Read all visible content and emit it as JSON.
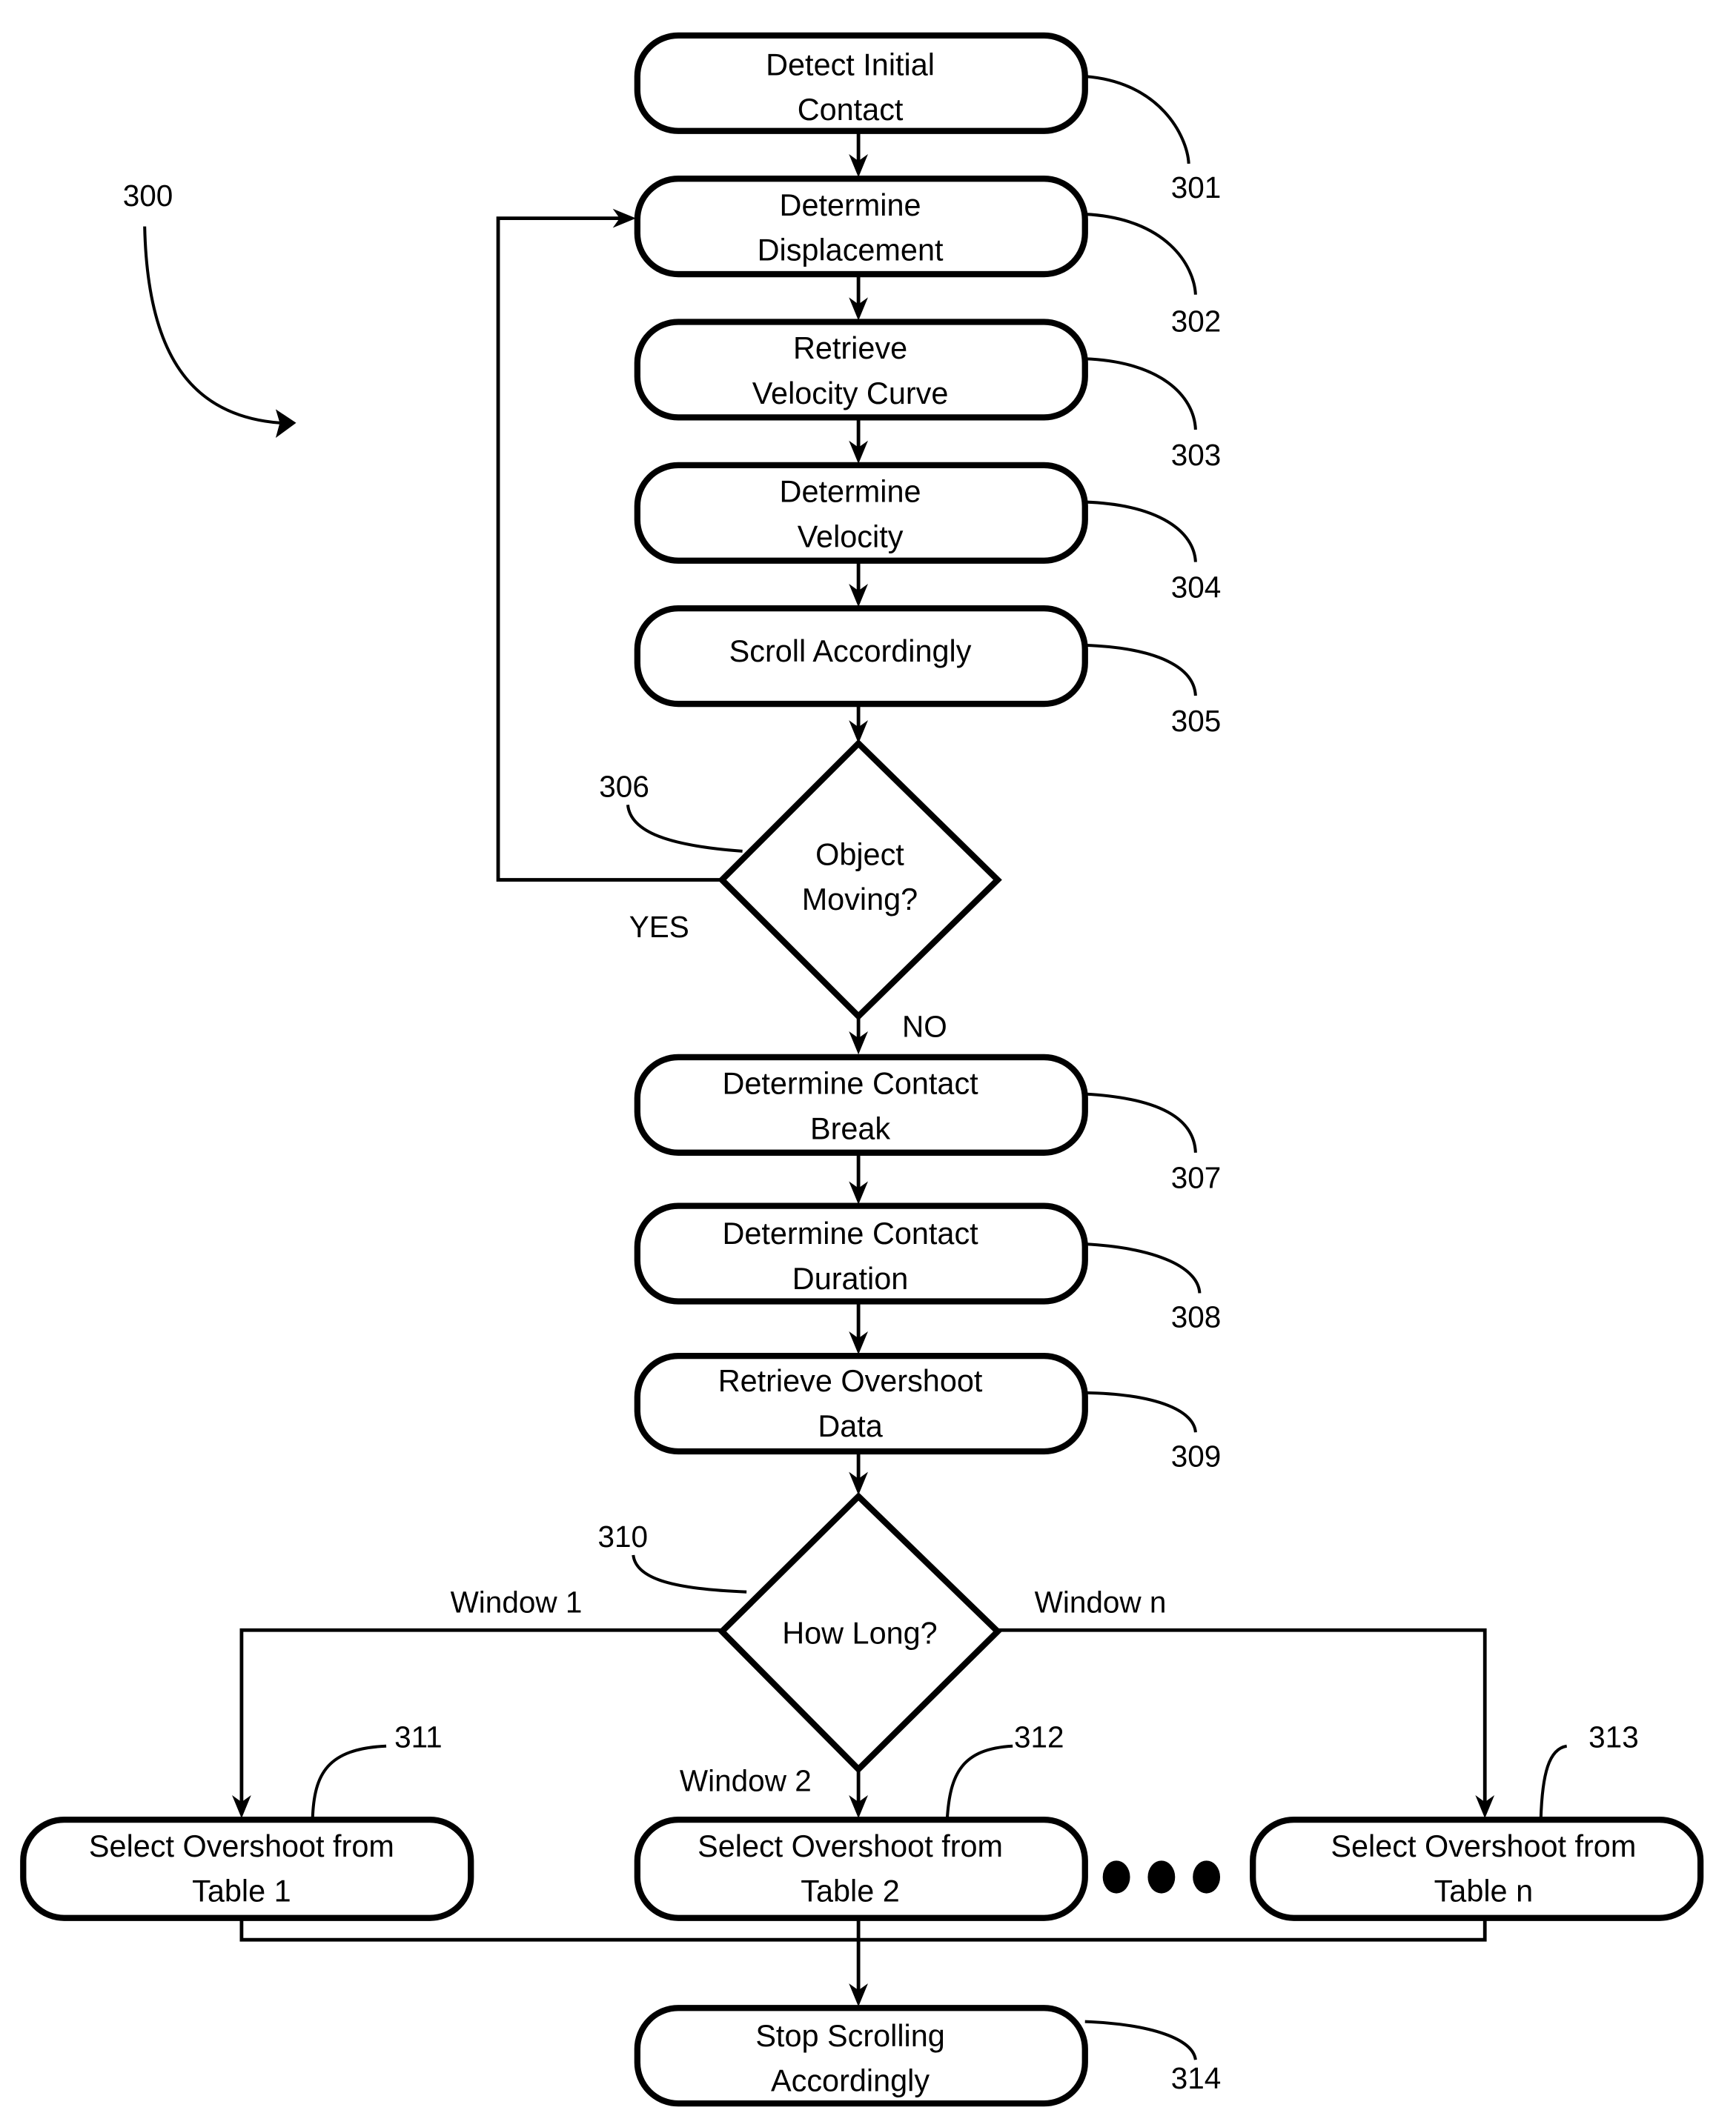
{
  "figure": {
    "ref": "300",
    "nodes": [
      {
        "id": "301",
        "type": "process",
        "lines": [
          "Detect Initial",
          "Contact"
        ]
      },
      {
        "id": "302",
        "type": "process",
        "lines": [
          "Determine",
          "Displacement"
        ]
      },
      {
        "id": "303",
        "type": "process",
        "lines": [
          "Retrieve",
          "Velocity Curve"
        ]
      },
      {
        "id": "304",
        "type": "process",
        "lines": [
          "Determine",
          "Velocity"
        ]
      },
      {
        "id": "305",
        "type": "process",
        "lines": [
          "Scroll Accordingly"
        ]
      },
      {
        "id": "306",
        "type": "decision",
        "lines": [
          "Object",
          "Moving?"
        ]
      },
      {
        "id": "307",
        "type": "process",
        "lines": [
          "Determine Contact",
          "Break"
        ]
      },
      {
        "id": "308",
        "type": "process",
        "lines": [
          "Determine Contact",
          "Duration"
        ]
      },
      {
        "id": "309",
        "type": "process",
        "lines": [
          "Retrieve Overshoot",
          "Data"
        ]
      },
      {
        "id": "310",
        "type": "decision",
        "lines": [
          "How Long?"
        ]
      },
      {
        "id": "311",
        "type": "process",
        "lines": [
          "Select Overshoot from",
          "Table 1"
        ]
      },
      {
        "id": "312",
        "type": "process",
        "lines": [
          "Select Overshoot from",
          "Table 2"
        ]
      },
      {
        "id": "313",
        "type": "process",
        "lines": [
          "Select Overshoot from",
          "Table n"
        ]
      },
      {
        "id": "314",
        "type": "process",
        "lines": [
          "Stop Scrolling",
          "Accordingly"
        ]
      }
    ],
    "edge_labels": {
      "yes": "YES",
      "no": "NO",
      "window1": "Window 1",
      "window2": "Window 2",
      "windown": "Window n"
    },
    "ellipsis": "●●●"
  }
}
